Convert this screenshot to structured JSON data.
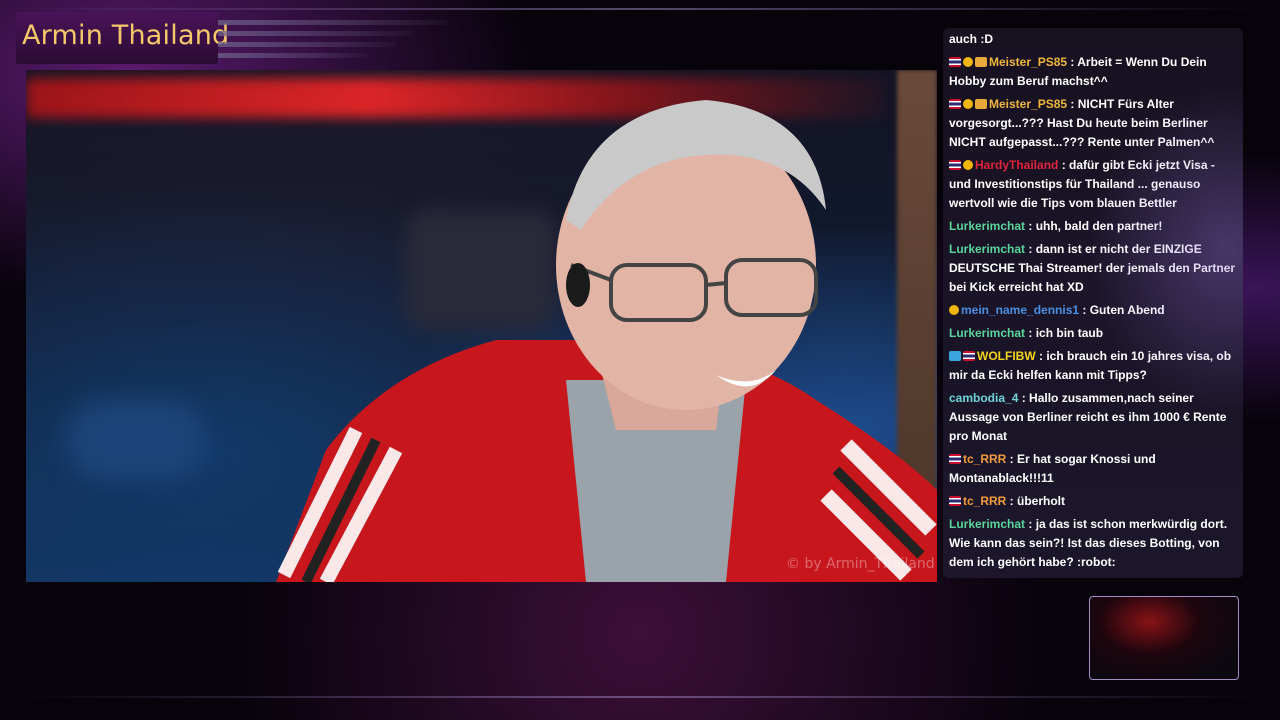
{
  "stream": {
    "title": "Armin Thailand",
    "watermark": "© by Armin_Thailand"
  },
  "colors": {
    "title": "#f5c86a",
    "user_gold": "#f0b63c",
    "user_red": "#e0243c",
    "user_green": "#5bd49c",
    "user_blue": "#4a90e2",
    "user_yellow": "#f2d21b",
    "user_teal": "#6fd3d8",
    "user_orange": "#f29a3c"
  },
  "chat": {
    "messages": [
      {
        "badges": [],
        "user": "",
        "color": "",
        "text": "auch :D"
      },
      {
        "badges": [
          "flag-icon",
          "og-badge-icon",
          "sub-badge-icon"
        ],
        "user": "Meister_PS85",
        "color": "#f0b63c",
        "text": " : Arbeit = Wenn Du Dein Hobby zum Beruf machst^^"
      },
      {
        "badges": [
          "flag-icon",
          "og-badge-icon",
          "sub-badge-icon"
        ],
        "user": "Meister_PS85",
        "color": "#f0b63c",
        "text": " : NICHT Fürs Alter vorgesorgt...??? Hast Du heute beim Berliner NICHT aufgepasst...??? Rente unter Palmen^^"
      },
      {
        "badges": [
          "flag-icon",
          "og-badge-icon"
        ],
        "user": "HardyThailand",
        "color": "#e0243c",
        "text": " : dafür gibt Ecki jetzt Visa - und Investitionstips für Thailand ... genauso wertvoll wie die Tips vom blauen Bettler"
      },
      {
        "badges": [],
        "user": "Lurkerimchat",
        "color": "#5bd49c",
        "text": " : uhh, bald den partner!"
      },
      {
        "badges": [],
        "user": "Lurkerimchat",
        "color": "#5bd49c",
        "text": " : dann ist er nicht der EINZIGE DEUTSCHE Thai Streamer! der jemals den Partner bei Kick erreicht hat XD"
      },
      {
        "badges": [
          "og-badge-icon"
        ],
        "user": "mein_name_dennis1",
        "color": "#4a90e2",
        "text": " : Guten Abend"
      },
      {
        "badges": [],
        "user": "Lurkerimchat",
        "color": "#5bd49c",
        "text": " : ich bin taub"
      },
      {
        "badges": [
          "vip-badge-icon",
          "flag-icon"
        ],
        "user": "WOLFIBW",
        "color": "#f2d21b",
        "text": " : ich brauch ein 10 jahres visa, ob mir da Ecki helfen kann mit Tipps?"
      },
      {
        "badges": [],
        "user": "cambodia_4",
        "color": "#6fd3d8",
        "text": " : Hallo zusammen,nach seiner Aussage von Berliner reicht es ihm 1000 € Rente pro Monat"
      },
      {
        "badges": [
          "flag-icon"
        ],
        "user": "tc_RRR",
        "color": "#f29a3c",
        "text": " : Er hat sogar Knossi und Montanablack!!!11"
      },
      {
        "badges": [
          "flag-icon"
        ],
        "user": "tc_RRR",
        "color": "#f29a3c",
        "text": " : überholt"
      },
      {
        "badges": [],
        "user": "Lurkerimchat",
        "color": "#5bd49c",
        "text": " : ja das ist schon merkwürdig dort. Wie kann das sein?! Ist das dieses Botting, von dem ich gehört habe? :robot:"
      }
    ]
  }
}
